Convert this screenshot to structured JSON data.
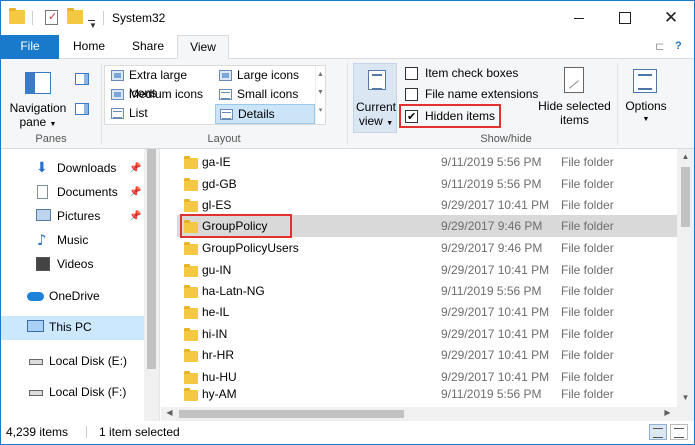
{
  "window": {
    "title": "System32"
  },
  "titlebar": {
    "quick_access": [
      "folder-icon",
      "properties-icon",
      "new-folder-icon",
      "customize-dropdown-icon"
    ],
    "controls": {
      "minimize": "–",
      "maximize": "☐",
      "close": "✕"
    }
  },
  "tabs": [
    {
      "label": "File"
    },
    {
      "label": "Home"
    },
    {
      "label": "Share"
    },
    {
      "label": "View"
    }
  ],
  "ribbon": {
    "panes": {
      "navigation_pane_label_line1": "Navigation",
      "navigation_pane_label_line2": "pane",
      "group_label": "Panes"
    },
    "layout": {
      "items": [
        {
          "label": "Extra large icons"
        },
        {
          "label": "Large icons"
        },
        {
          "label": "Medium icons"
        },
        {
          "label": "Small icons"
        },
        {
          "label": "List"
        },
        {
          "label": "Details"
        }
      ],
      "selected": "Details",
      "group_label": "Layout"
    },
    "current_view": {
      "line1": "Current",
      "line2": "view"
    },
    "show_hide": {
      "item_check_boxes": {
        "label": "Item check boxes",
        "checked": false
      },
      "file_name_extensions": {
        "label": "File name extensions",
        "checked": false
      },
      "hidden_items": {
        "label": "Hidden items",
        "checked": true
      },
      "hide_selected_line1": "Hide selected",
      "hide_selected_line2": "items",
      "group_label": "Show/hide"
    },
    "options": {
      "label": "Options"
    }
  },
  "navpane": {
    "items": [
      {
        "label": "Downloads",
        "icon": "download-arrow-icon",
        "pinned": true
      },
      {
        "label": "Documents",
        "icon": "document-icon",
        "pinned": true
      },
      {
        "label": "Pictures",
        "icon": "picture-icon",
        "pinned": true
      },
      {
        "label": "Music",
        "icon": "music-note-icon",
        "pinned": false
      },
      {
        "label": "Videos",
        "icon": "video-icon",
        "pinned": false
      },
      {
        "label": "OneDrive",
        "icon": "cloud-icon",
        "pinned": false
      },
      {
        "label": "This PC",
        "icon": "computer-icon",
        "pinned": false,
        "selected": true
      },
      {
        "label": "Local Disk (E:)",
        "icon": "drive-icon",
        "pinned": false
      },
      {
        "label": "Local Disk (F:)",
        "icon": "drive-icon",
        "pinned": false
      }
    ]
  },
  "files": [
    {
      "name": "ga-IE",
      "date": "9/11/2019 5:56 PM",
      "type": "File folder"
    },
    {
      "name": "gd-GB",
      "date": "9/11/2019 5:56 PM",
      "type": "File folder"
    },
    {
      "name": "gl-ES",
      "date": "9/29/2017 10:41 PM",
      "type": "File folder"
    },
    {
      "name": "GroupPolicy",
      "date": "9/29/2017 9:46 PM",
      "type": "File folder",
      "selected": true
    },
    {
      "name": "GroupPolicyUsers",
      "date": "9/29/2017 9:46 PM",
      "type": "File folder"
    },
    {
      "name": "gu-IN",
      "date": "9/29/2017 10:41 PM",
      "type": "File folder"
    },
    {
      "name": "ha-Latn-NG",
      "date": "9/11/2019 5:56 PM",
      "type": "File folder"
    },
    {
      "name": "he-IL",
      "date": "9/29/2017 10:41 PM",
      "type": "File folder"
    },
    {
      "name": "hi-IN",
      "date": "9/29/2017 10:41 PM",
      "type": "File folder"
    },
    {
      "name": "hr-HR",
      "date": "9/29/2017 10:41 PM",
      "type": "File folder"
    },
    {
      "name": "hu-HU",
      "date": "9/29/2017 10:41 PM",
      "type": "File folder"
    },
    {
      "name": "hy-AM",
      "date": "9/11/2019 5:56 PM",
      "type": "File folder"
    }
  ],
  "statusbar": {
    "item_count": "4,239 items",
    "selected_count": "1 item selected"
  },
  "colors": {
    "accent": "#1979ca",
    "highlight_box": "#e23131",
    "selection": "#cce8ff"
  }
}
